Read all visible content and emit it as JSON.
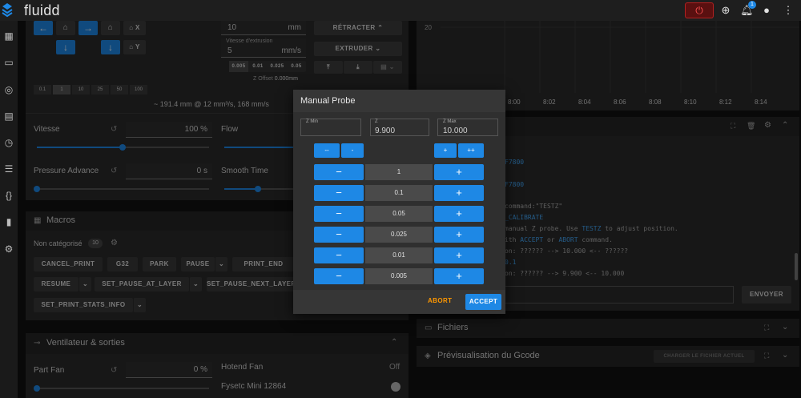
{
  "app": {
    "name": "fluidd",
    "notifications": "1"
  },
  "toolhead": {
    "x_home": "X",
    "y_home": "Y",
    "steps": [
      "0.1",
      "1",
      "10",
      "25",
      "50",
      "100"
    ],
    "retract_len": "10",
    "retract_unit": "mm",
    "speed_label": "Vitesse d'extrusion",
    "speed_val": "5",
    "speed_unit": "mm/s",
    "retract_btn": "RÉTRACTER",
    "extrude_btn": "EXTRUDER",
    "z_steps": [
      "0.005",
      "0.01",
      "0.025",
      "0.05"
    ],
    "z_offset_label": "Z Offset",
    "z_offset_val": "0.000mm",
    "flow_info": "~ 191.4 mm @ 12 mm³/s, 168 mm/s"
  },
  "adjust": {
    "speed_label": "Vitesse",
    "speed_val": "100 %",
    "flow_label": "Flow",
    "pa_label": "Pressure Advance",
    "pa_val": "0 s",
    "st_label": "Smooth Time"
  },
  "macros": {
    "title": "Macros",
    "group": "Non catégorisé",
    "count": "10",
    "row1": [
      "CANCEL_PRINT",
      "G32",
      "PARK",
      "PAUSE",
      "PRINT_END"
    ],
    "row2": [
      "RESUME",
      "SET_PAUSE_AT_LAYER",
      "SET_PAUSE_NEXT_LAYER"
    ],
    "row3": [
      "SET_PRINT_STATS_INFO"
    ]
  },
  "fans": {
    "title": "Ventilateur & sorties",
    "part_label": "Part Fan",
    "part_val": "0 %",
    "hotend_label": "Hotend Fan",
    "hotend_val": "Off",
    "mcu_label": "Fysetc Mini 12864"
  },
  "chart": {
    "ytick": "20",
    "xticks": [
      "8:00",
      "8:02",
      "8:04",
      "8:06",
      "8:08",
      "8:10",
      "8:12",
      "8:14"
    ]
  },
  "console": {
    "frag1": "F7800",
    "frag2": "F7800",
    "frag3": "command:\"TESTZ\"",
    "frag4": "_CALIBRATE",
    "frag5a": "manual Z probe. Use ",
    "frag5b": "TESTZ",
    "frag5c": " to adjust position.",
    "frag6a": "ith ",
    "frag6b": "ACCEPT",
    "frag6c": " or ",
    "frag6d": "ABORT",
    "frag6e": " command.",
    "frag7": "on: ?????? --> 10.000 <-- ??????",
    "frag8": "0.1",
    "frag9": "on: ?????? --> 9.900 <-- 10.000",
    "send": "ENVOYER"
  },
  "files": {
    "title": "Fichiers"
  },
  "gcode": {
    "title": "Prévisualisation du Gcode",
    "load": "CHARGER LE FICHIER ACTUEL"
  },
  "probe": {
    "title": "Manual Probe",
    "zmin_label": "Z Min",
    "zmin_val": "",
    "z_label": "Z",
    "z_val": "9.900",
    "zmax_label": "Z Max",
    "zmax_val": "10.000",
    "coarse": [
      "--",
      "-",
      "+",
      "++"
    ],
    "rows": [
      "1",
      "0.1",
      "0.05",
      "0.025",
      "0.01",
      "0.005"
    ],
    "minus": "−",
    "plus": "+",
    "abort": "ABORT",
    "accept": "ACCEPT"
  }
}
